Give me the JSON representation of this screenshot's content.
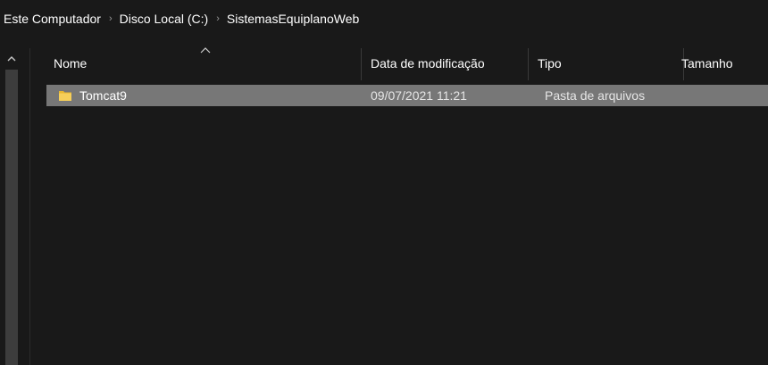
{
  "breadcrumb": {
    "items": [
      "Este Computador",
      "Disco Local (C:)",
      "SistemasEquiplanoWeb"
    ],
    "separator": "›"
  },
  "nav_pane": {
    "scroll_up_icon": "chevron-up-icon"
  },
  "columns": [
    {
      "label": "Nome"
    },
    {
      "label": "Data de modificação"
    },
    {
      "label": "Tipo"
    },
    {
      "label": "Tamanho"
    }
  ],
  "sort_indicator": "^",
  "files": [
    {
      "name": "Tomcat9",
      "modified": "09/07/2021 11:21",
      "type": "Pasta de arquivos",
      "size": "",
      "icon": "folder-icon",
      "selected": true
    }
  ],
  "colors": {
    "background": "#191919",
    "selection": "#777777",
    "folder": "#f0c040"
  }
}
